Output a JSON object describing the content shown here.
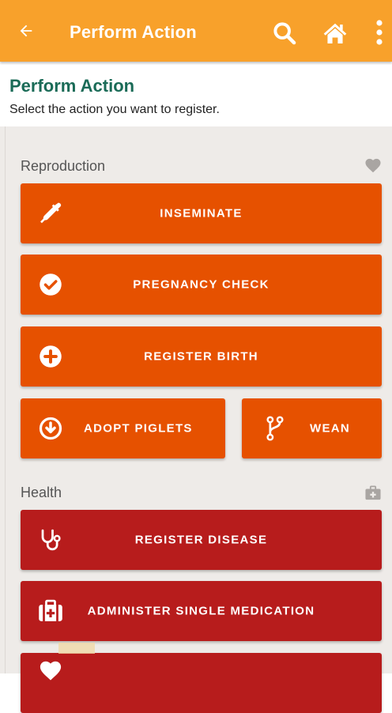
{
  "appbar": {
    "title": "Perform Action",
    "back_icon": "arrow-left-icon",
    "search_icon": "search-icon",
    "home_icon": "home-icon",
    "more_icon": "more-vertical-icon",
    "color": "#f8a12b"
  },
  "header": {
    "title": "Perform Action",
    "subtitle": "Select the action you want to register."
  },
  "sections": {
    "reproduction": {
      "title": "Reproduction",
      "icon": "heart-icon",
      "color": "#e65100",
      "buttons": {
        "inseminate": {
          "label": "INSEMINATE",
          "icon": "dropper-icon"
        },
        "pregnancy_check": {
          "label": "PREGNANCY CHECK",
          "icon": "check-circle-icon"
        },
        "register_birth": {
          "label": "REGISTER BIRTH",
          "icon": "plus-circle-icon"
        },
        "adopt_piglets": {
          "label": "ADOPT PIGLETS",
          "icon": "arrow-down-circle-icon"
        },
        "wean": {
          "label": "WEAN",
          "icon": "code-branch-icon"
        }
      }
    },
    "health": {
      "title": "Health",
      "icon": "medkit-icon",
      "color": "#b71c1c",
      "buttons": {
        "register_disease": {
          "label": "REGISTER DISEASE",
          "icon": "stethoscope-icon"
        },
        "administer_single_medication": {
          "label": "ADMINISTER SINGLE MEDICATION",
          "icon": "medkit-icon"
        },
        "next_partial": {
          "icon": "heart-icon"
        }
      }
    }
  }
}
